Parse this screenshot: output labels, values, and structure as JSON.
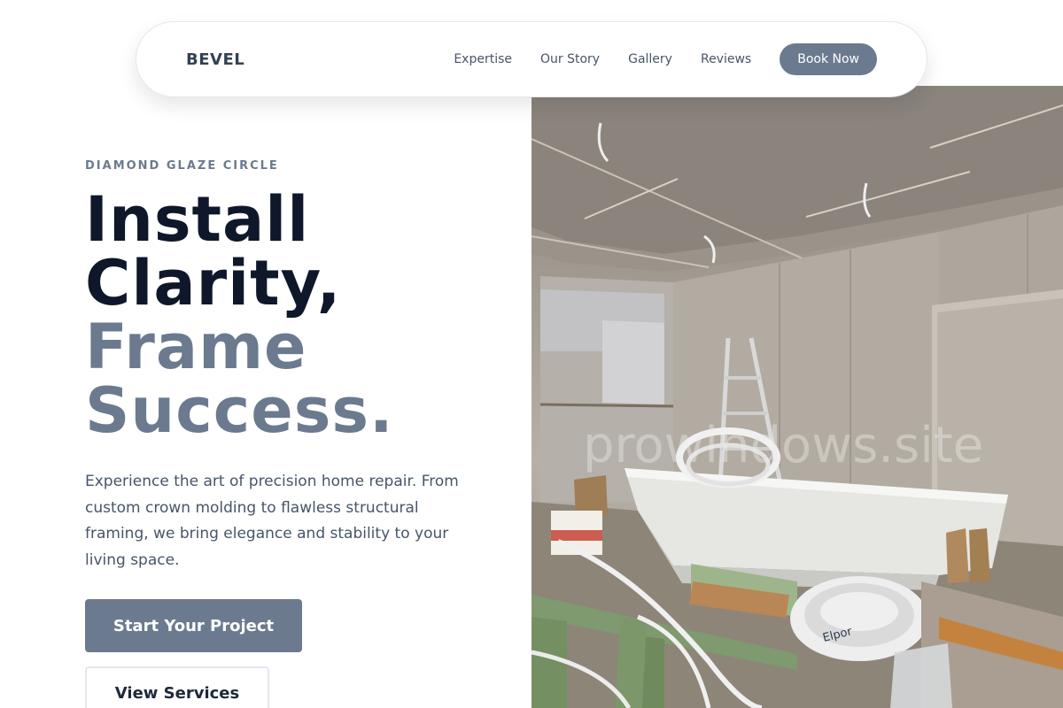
{
  "nav": {
    "brand": "BEVEL",
    "links": [
      "Expertise",
      "Our Story",
      "Gallery",
      "Reviews"
    ],
    "cta": "Book Now"
  },
  "hero": {
    "eyebrow": "DIAMOND GLAZE CIRCLE",
    "headline_line1": "Install",
    "headline_line2": "Clarity,",
    "headline_line3": "Frame",
    "headline_line4": "Success.",
    "lead": "Experience the art of precision home repair. From custom crown molding to flawless structural framing, we bring elegance and stability to your living space.",
    "primary_button": "Start Your Project",
    "secondary_button": "View Services",
    "image_watermark": "prowindows.site"
  },
  "colors": {
    "accent": "#6b7a8f",
    "heading_dark": "#0f172a",
    "body_text": "#475569"
  }
}
